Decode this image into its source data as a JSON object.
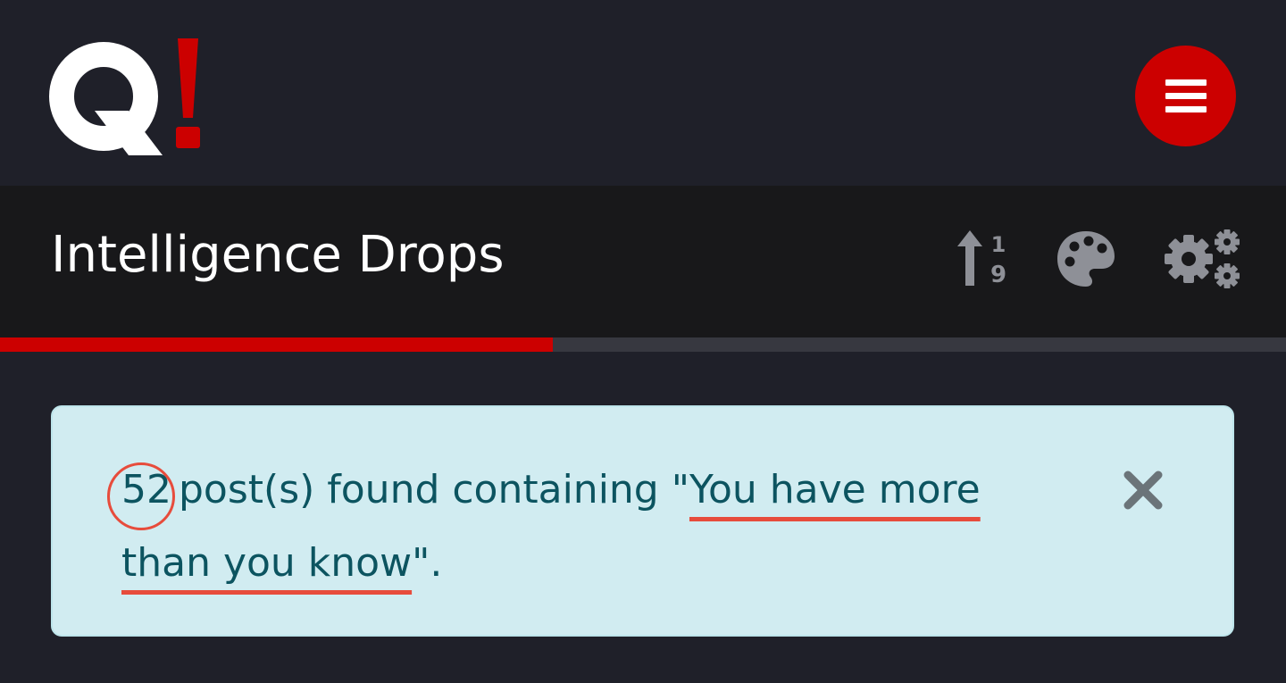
{
  "header": {
    "logo_text": "Q!",
    "menu_icon": "hamburger-menu-icon",
    "brand_color": "#cc0000"
  },
  "title_bar": {
    "title": "Intelligence Drops",
    "tools": [
      {
        "name": "sort-numeric-icon",
        "label": ""
      },
      {
        "name": "palette-icon",
        "label": ""
      },
      {
        "name": "settings-gears-icon",
        "label": ""
      }
    ]
  },
  "progress": {
    "fraction": 0.43
  },
  "alert": {
    "count": "52",
    "text_before_query": "post(s) found containing \"",
    "query": "You have more than you know",
    "text_after_query": "\".",
    "close_icon": "close-icon",
    "highlight_color": "#e74c3c"
  }
}
